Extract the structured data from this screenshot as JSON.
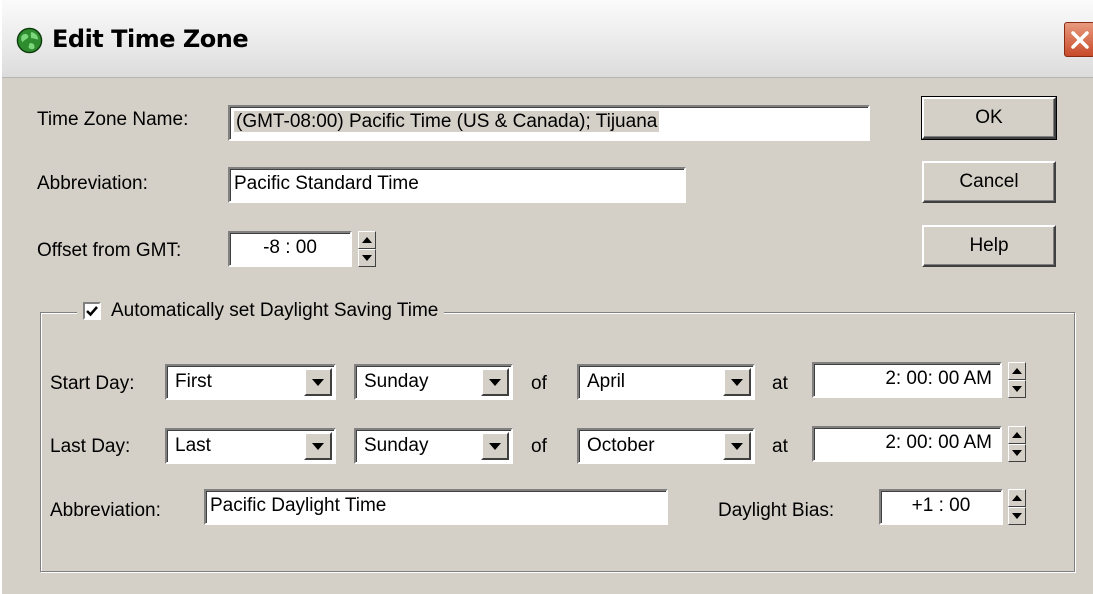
{
  "window": {
    "title": "Edit Time Zone",
    "close_label": "✕"
  },
  "fields": {
    "time_zone_name_label": "Time Zone Name:",
    "time_zone_name_value": "(GMT-08:00) Pacific Time (US & Canada); Tijuana",
    "abbreviation_label": "Abbreviation:",
    "abbreviation_value": "Pacific Standard Time",
    "offset_label": "Offset from GMT:",
    "offset_value": "-8 : 00"
  },
  "buttons": {
    "ok": "OK",
    "cancel": "Cancel",
    "help": "Help"
  },
  "dst": {
    "checkbox_label": "Automatically set Daylight Saving Time",
    "checked": true,
    "start_label": "Start Day:",
    "start_week": "First",
    "start_day": "Sunday",
    "start_of": "of",
    "start_month": "April",
    "start_at": "at",
    "start_time": "2: 00: 00 AM",
    "last_label": "Last Day:",
    "last_week": "Last",
    "last_day": "Sunday",
    "last_of": "of",
    "last_month": "October",
    "last_at": "at",
    "last_time": "2: 00: 00 AM",
    "abbreviation_label": "Abbreviation:",
    "abbreviation_value": "Pacific Daylight Time",
    "bias_label": "Daylight Bias:",
    "bias_value": "+1 : 00"
  },
  "icons": {
    "title": "globe-icon",
    "close": "close-icon",
    "dropdown": "chevron-down-icon",
    "spin": "spinner-arrows-icon",
    "check": "checkmark-icon"
  },
  "colors": {
    "face": "#d4d0c8",
    "close_red": "#c84a2a",
    "globe_green": "#2e8b2e"
  }
}
